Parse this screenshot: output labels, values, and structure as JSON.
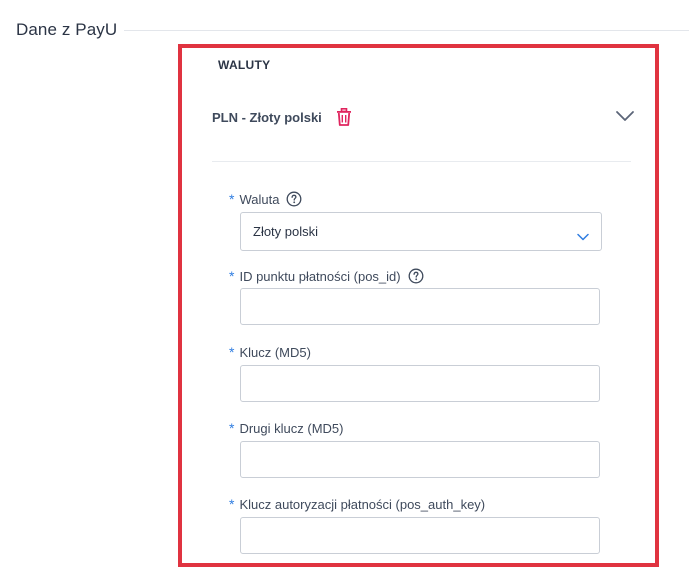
{
  "section": {
    "title": "Dane z PayU"
  },
  "currencies": {
    "heading": "WALUTY",
    "item": {
      "title": "PLN - Złoty polski"
    }
  },
  "form": {
    "required_mark": "*",
    "currency": {
      "label": "Waluta",
      "value": "Złoty polski"
    },
    "pos_id": {
      "label": "ID punktu płatności (pos_id)",
      "value": ""
    },
    "key_md5": {
      "label": "Klucz (MD5)",
      "value": ""
    },
    "second_key_md5": {
      "label": "Drugi klucz (MD5)",
      "value": ""
    },
    "pos_auth_key": {
      "label": "Klucz autoryzacji płatności (pos_auth_key)",
      "value": ""
    }
  },
  "colors": {
    "highlight_border": "#e03340",
    "required_asterisk": "#2f7de1",
    "trash_icon": "#e0245e",
    "text": "#2b3445"
  },
  "icons": [
    "trash-icon",
    "chevron-down-icon",
    "help-icon",
    "select-chevron-icon"
  ]
}
